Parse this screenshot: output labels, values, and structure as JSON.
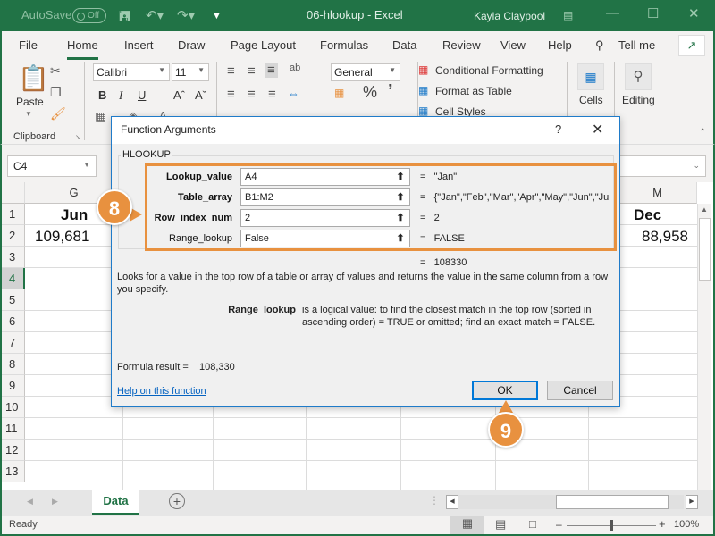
{
  "titlebar": {
    "autosave_label": "AutoSave",
    "autosave_state": "Off",
    "doc_title": "06-hlookup  -  Excel",
    "user_name": "Kayla Claypool"
  },
  "menu": {
    "items": [
      "File",
      "Home",
      "Insert",
      "Draw",
      "Page Layout",
      "Formulas",
      "Data",
      "Review",
      "View",
      "Help"
    ],
    "active": "Home",
    "tell_me": "Tell me"
  },
  "ribbon": {
    "paste_label": "Paste",
    "clipboard_label": "Clipboard",
    "font_name": "Calibri",
    "font_size": "11",
    "number_format": "General",
    "conditional_formatting": "Conditional Formatting",
    "format_as_table": "Format as Table",
    "cell_styles": "Cell Styles",
    "cells_label": "Cells",
    "editing_label": "Editing"
  },
  "formula_bar": {
    "name_box": "C4"
  },
  "grid": {
    "columns": [
      "G",
      "M"
    ],
    "rows": [
      "1",
      "2",
      "3",
      "4",
      "5",
      "6",
      "7",
      "8",
      "9",
      "10",
      "11",
      "12",
      "13"
    ],
    "selected_row": "4",
    "cells": {
      "G1": "Jun",
      "G2": "109,681",
      "M1": "Dec",
      "M2": "88,958"
    }
  },
  "sheets": {
    "tabs": [
      "Data"
    ],
    "active": "Data"
  },
  "status": {
    "text": "Ready",
    "zoom": "100%"
  },
  "dialog": {
    "title": "Function Arguments",
    "help_glyph": "?",
    "function_name": "HLOOKUP",
    "args": [
      {
        "label": "Lookup_value",
        "bold": true,
        "value": "A4",
        "result": "\"Jan\""
      },
      {
        "label": "Table_array",
        "bold": true,
        "value": "B1:M2",
        "result": "{\"Jan\",\"Feb\",\"Mar\",\"Apr\",\"May\",\"Jun\",\"Jul\""
      },
      {
        "label": "Row_index_num",
        "bold": true,
        "value": "2",
        "result": "2"
      },
      {
        "label": "Range_lookup",
        "bold": false,
        "value": "False",
        "result": "FALSE"
      }
    ],
    "eq_sign": "=",
    "overall_result": "108330",
    "description": "Looks for a value in the top row of a table or array of values and returns the value in the same column from a row you specify.",
    "arg_help_name": "Range_lookup",
    "arg_help_text": "is a logical value: to find the closest match in the top row (sorted in ascending order) = TRUE or omitted; find an exact match = FALSE.",
    "formula_result_label": "Formula result =",
    "formula_result_value": "108,330",
    "help_link": "Help on this function",
    "ok_label": "OK",
    "cancel_label": "Cancel"
  },
  "callouts": {
    "step_8": "8",
    "step_9": "9"
  },
  "colors": {
    "excel_green": "#217346",
    "callout_orange": "#e8913f",
    "dialog_border": "#1f7bc9",
    "link_blue": "#0563c1"
  }
}
